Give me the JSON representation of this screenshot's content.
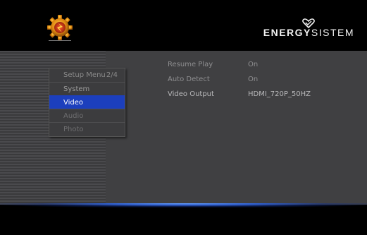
{
  "brand": {
    "name_bold": "ENERGY",
    "name_light": "SISTEM"
  },
  "menu": {
    "title": "Setup Menu",
    "page": "2/4",
    "items": [
      {
        "label": "System",
        "state": "normal"
      },
      {
        "label": "Video",
        "state": "selected"
      },
      {
        "label": "Audio",
        "state": "dim"
      },
      {
        "label": "Photo",
        "state": "dim"
      }
    ]
  },
  "settings": [
    {
      "label": "Resume Play",
      "value": "On"
    },
    {
      "label": "Auto Detect",
      "value": "On"
    },
    {
      "label": "Video Output",
      "value": "HDMI_720P_50HZ"
    }
  ],
  "colors": {
    "selection": "#1c3fbd",
    "panel": "#3e3e40",
    "glow": "#4a7bf0"
  },
  "icons": {
    "logo": "gear-logo-icon",
    "brand_mark": "heart-logo-icon"
  }
}
